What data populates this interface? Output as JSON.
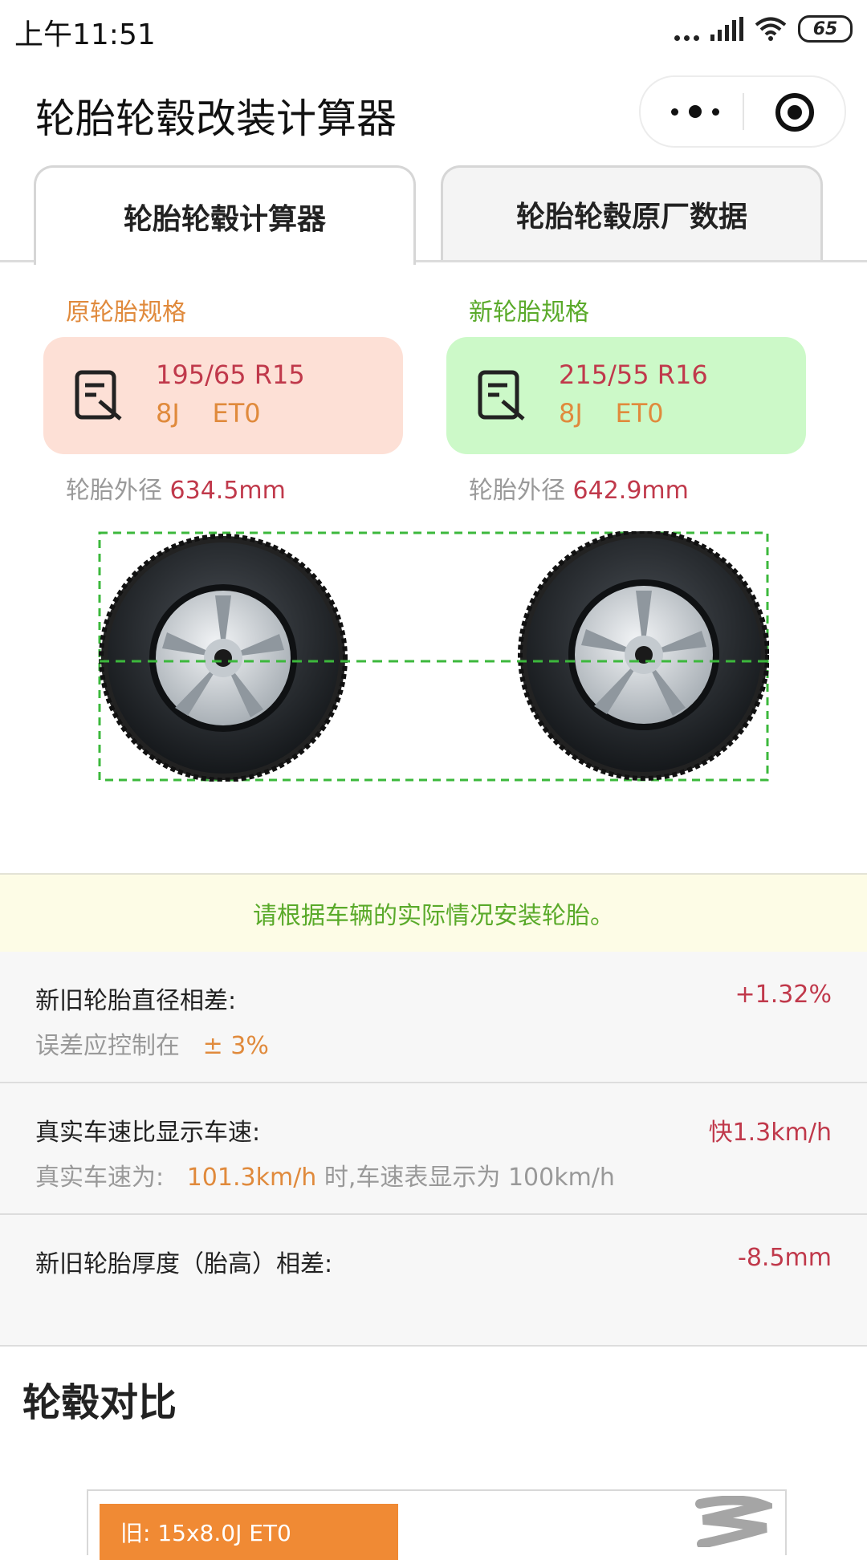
{
  "status_bar": {
    "time": "上午11:51",
    "battery": "65"
  },
  "title_bar": {
    "title": "轮胎轮毂改装计算器"
  },
  "tabs": [
    {
      "label": "轮胎轮毂计算器",
      "active": true
    },
    {
      "label": "轮胎轮毂原厂数据",
      "active": false
    }
  ],
  "original": {
    "label": "原轮胎规格",
    "tire": "195/65 R15",
    "rim": "8J    ET0",
    "diameter_label": "轮胎外径",
    "diameter_value": "634.5mm",
    "card_color": "#fde0d6",
    "label_color": "#e08a3c"
  },
  "new": {
    "label": "新轮胎规格",
    "tire": "215/55 R16",
    "rim": "8J    ET0",
    "diameter_label": "轮胎外径",
    "diameter_value": "642.9mm",
    "card_color": "#ccf9c8",
    "label_color": "#5aaa2a"
  },
  "notice": "请根据车辆的实际情况安装轮胎。",
  "results": {
    "diameter_diff": {
      "label": "新旧轮胎直径相差:",
      "value": "+1.32%",
      "sub_prefix": "误差应控制在",
      "sub_highlight": "± 3%"
    },
    "speed": {
      "label": "真实车速比显示车速:",
      "value": "快1.3km/h",
      "sub_prefix": "真实车速为:",
      "sub_highlight": "101.3km/h",
      "sub_suffix": "时,车速表显示为 100km/h"
    },
    "sidewall": {
      "label": "新旧轮胎厚度（胎高）相差:",
      "value": "-8.5mm"
    }
  },
  "rim_compare": {
    "title": "轮毂对比",
    "old_label": "旧: 15x8.0J ET0"
  },
  "colors": {
    "accent_red": "#c0394b",
    "accent_orange": "#e08a3c",
    "accent_green": "#5aaa2a",
    "guide_line": "#3cb83c"
  },
  "icons": [
    "more-icon",
    "target-icon",
    "edit-note-icon",
    "tire-wheel-icon"
  ]
}
